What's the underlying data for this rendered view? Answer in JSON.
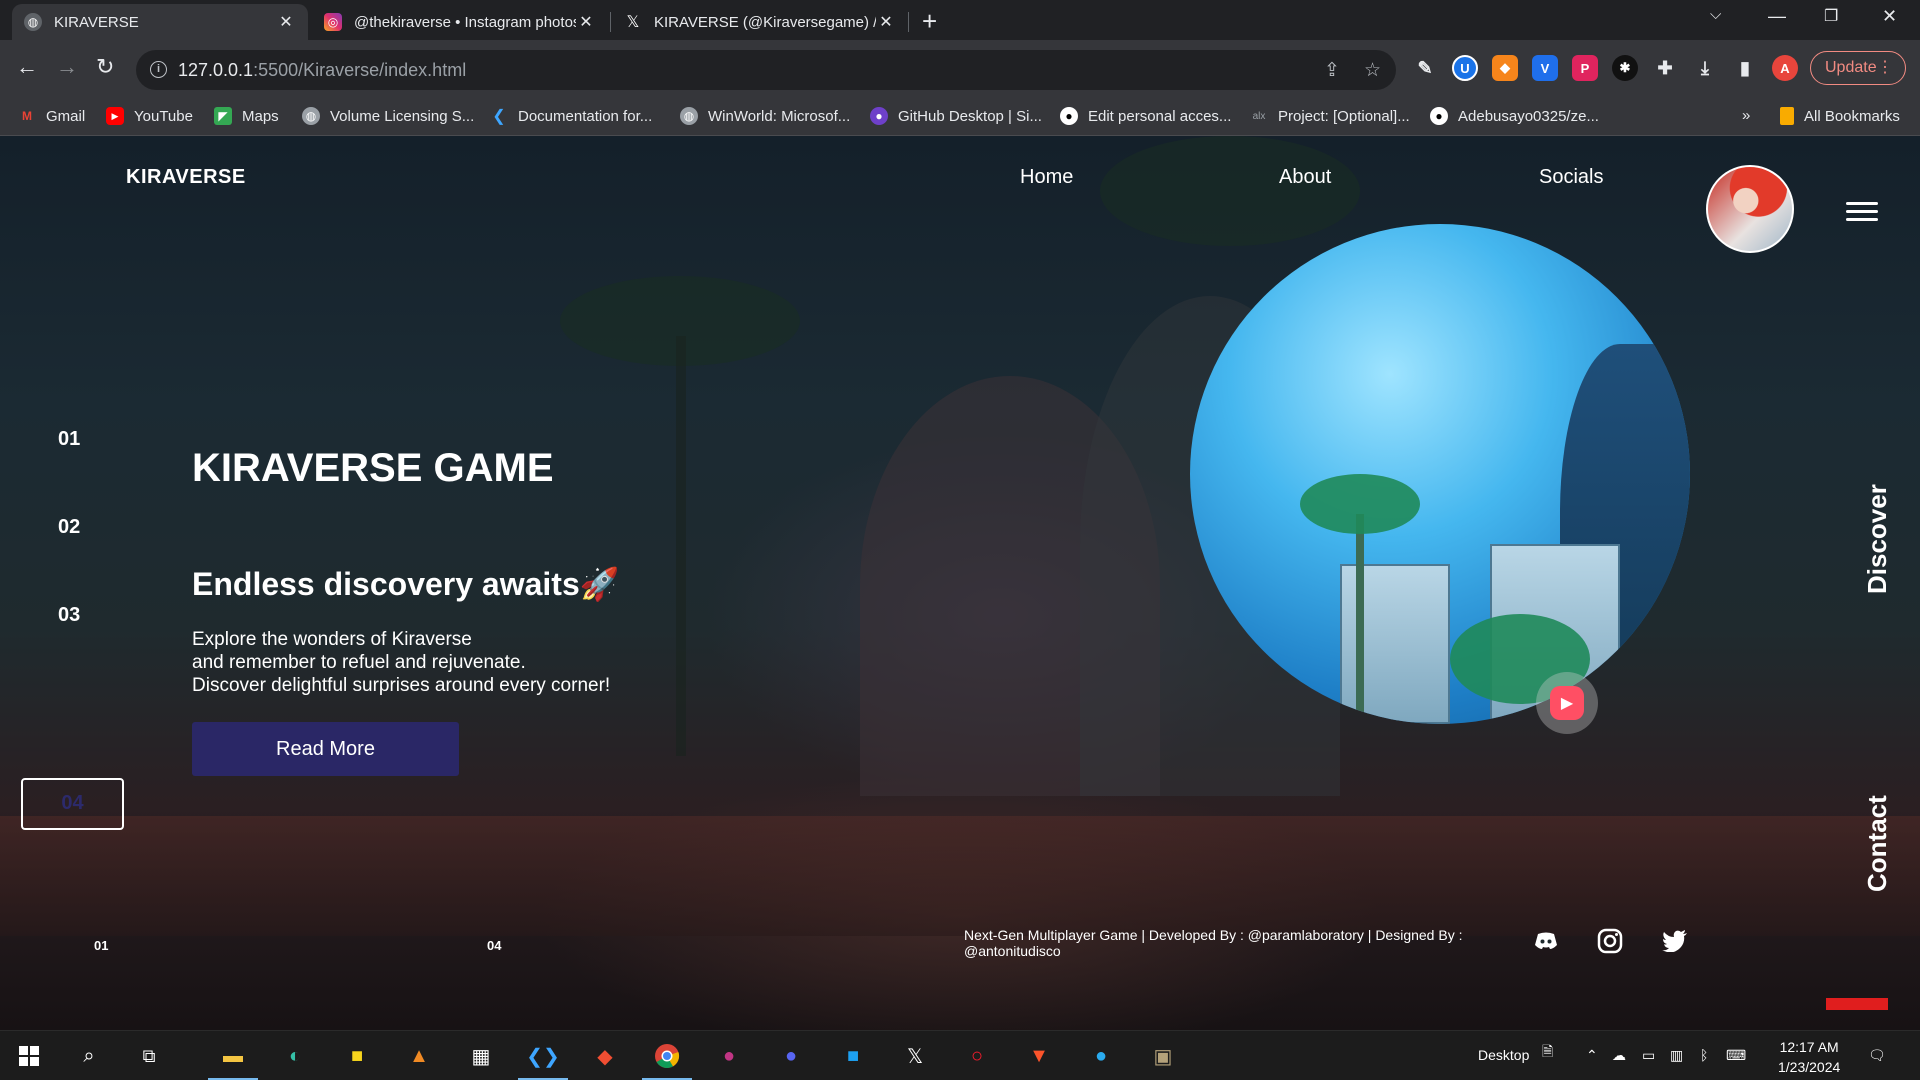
{
  "browser": {
    "tabs": [
      {
        "title": "KIRAVERSE",
        "active": true
      },
      {
        "title": "@thekiraverse • Instagram photos",
        "active": false
      },
      {
        "title": "KIRAVERSE (@Kiraversegame) / X",
        "active": false
      }
    ],
    "url_host": "127.0.0.1",
    "url_path": ":5500/Kiraverse/index.html",
    "update_label": "Update",
    "profile_initial": "A",
    "bookmarks": [
      "Gmail",
      "YouTube",
      "Maps",
      "Volume Licensing S...",
      "Documentation for...",
      "WinWorld: Microsof...",
      "GitHub Desktop | Si...",
      "Edit personal acces...",
      "Project: [Optional]...",
      "Adebusayo0325/ze..."
    ],
    "bookmarks_overflow": "»",
    "all_bookmarks": "All Bookmarks"
  },
  "site": {
    "logo": "KIRAVERSE",
    "nav": [
      "Home",
      "About",
      "Socials"
    ],
    "slides": [
      "01",
      "02",
      "03",
      "04"
    ],
    "active_slide": "04",
    "hero_title": "KIRAVERSE GAME",
    "hero_subtitle": "Endless discovery awaits🚀",
    "hero_lines": [
      "Explore the wonders of Kiraverse",
      "and remember to refuel and rejuvenate.",
      "Discover delightful surprises around every corner!"
    ],
    "cta": "Read More",
    "side_labels": [
      "Discover",
      "Contact"
    ],
    "footer_start": "01",
    "footer_end": "04",
    "footer_text": "Next-Gen Multiplayer Game | Developed By : @paramlaboratory | Designed By : @antonitudisco",
    "socials": [
      "discord-icon",
      "instagram-icon",
      "twitter-icon"
    ]
  },
  "taskbar": {
    "desktop_label": "Desktop",
    "time": "12:17 AM",
    "date": "1/23/2024"
  },
  "colors": {
    "accent_button": "#2a2766",
    "update_red": "#f28b82",
    "brand_red": "#e01e1e"
  }
}
